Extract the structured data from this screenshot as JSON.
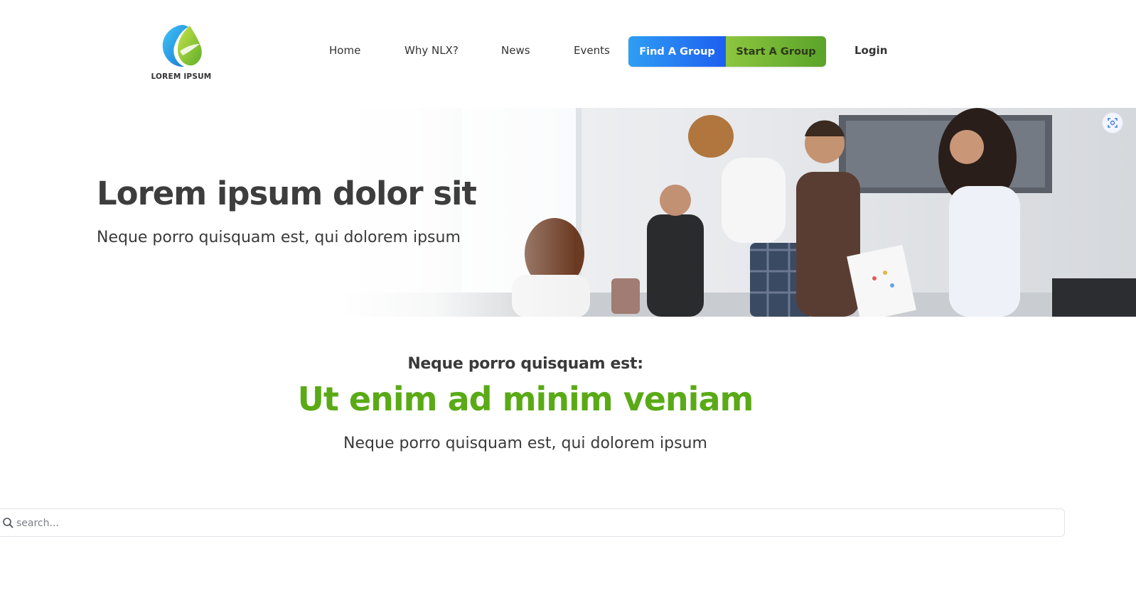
{
  "brand": {
    "logo_text": "LOREM IPSUM",
    "logo_icon": "leaf-drop-logo-icon",
    "colors": {
      "blue": "#2f9ef3",
      "green": "#8dc63f"
    }
  },
  "nav": {
    "home": "Home",
    "why": "Why NLX?",
    "news": "News",
    "events": "Events",
    "find_group": "Find A Group",
    "start_group": "Start A Group",
    "login": "Login"
  },
  "hero": {
    "title": "Lorem ipsum dolor sit",
    "subtitle": "Neque porro quisquam est, qui dolorem ipsum",
    "image": "office-team-photo"
  },
  "intro": {
    "kicker": "Neque porro quisquam est:",
    "title": "Ut enim ad minim veniam",
    "subtitle": "Neque porro quisquam est, qui dolorem ipsum",
    "title_color": "#5aaa16"
  },
  "search": {
    "placeholder": "search...",
    "value": "",
    "icon": "search-icon"
  }
}
